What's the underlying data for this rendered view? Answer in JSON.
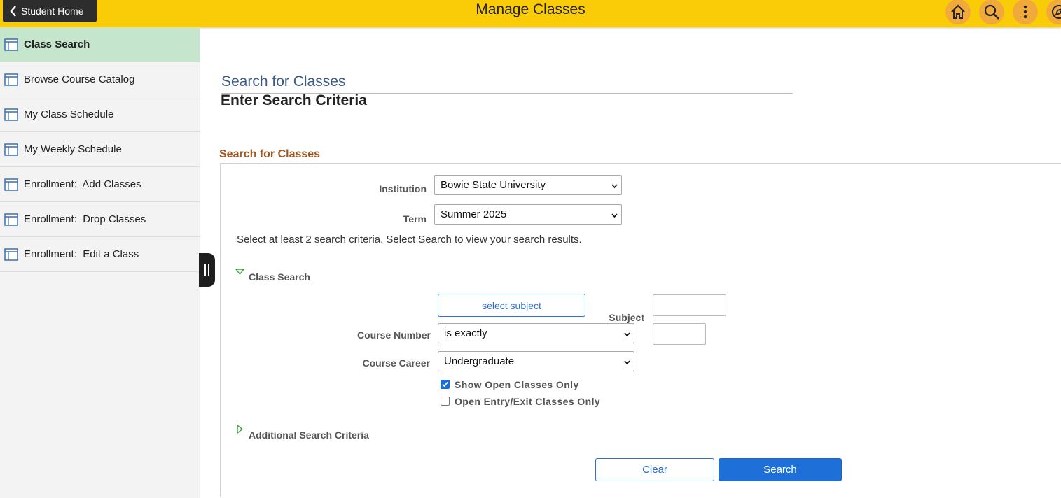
{
  "header": {
    "back_label": "Student Home",
    "title": "Manage Classes",
    "icons": [
      "home-icon",
      "search-icon",
      "more-options-icon",
      "navbar-compass-icon"
    ],
    "bar_color": "#f9cc07"
  },
  "sidebar": {
    "items": [
      {
        "label": "Class Search",
        "active": true
      },
      {
        "label": "Browse Course Catalog",
        "active": false
      },
      {
        "label": "My Class Schedule",
        "active": false
      },
      {
        "label": "My Weekly Schedule",
        "active": false
      },
      {
        "label": "Enrollment:  Add Classes",
        "active": false
      },
      {
        "label": "Enrollment:  Drop Classes",
        "active": false
      },
      {
        "label": "Enrollment:  Edit a Class",
        "active": false
      }
    ]
  },
  "main": {
    "subtitle": "Search for Classes",
    "title": "Enter Search Criteria",
    "section_header": "Search for Classes",
    "institution": {
      "label": "Institution",
      "value": "Bowie State University"
    },
    "term": {
      "label": "Term",
      "value": "Summer 2025"
    },
    "instructions": "Select at least 2 search criteria. Select Search to view your search results.",
    "class_search_group": "Class Search",
    "select_subject_button": "select subject",
    "subject_label": "Subject",
    "course_number": {
      "label": "Course Number",
      "operator": "is exactly"
    },
    "course_career": {
      "label": "Course Career",
      "value": "Undergraduate"
    },
    "show_open_only": {
      "label": "Show Open Classes Only",
      "checked": true
    },
    "open_entry_exit": {
      "label": "Open Entry/Exit Classes Only",
      "checked": false
    },
    "additional_criteria": "Additional Search Criteria",
    "clear_button": "Clear",
    "search_button": "Search"
  }
}
